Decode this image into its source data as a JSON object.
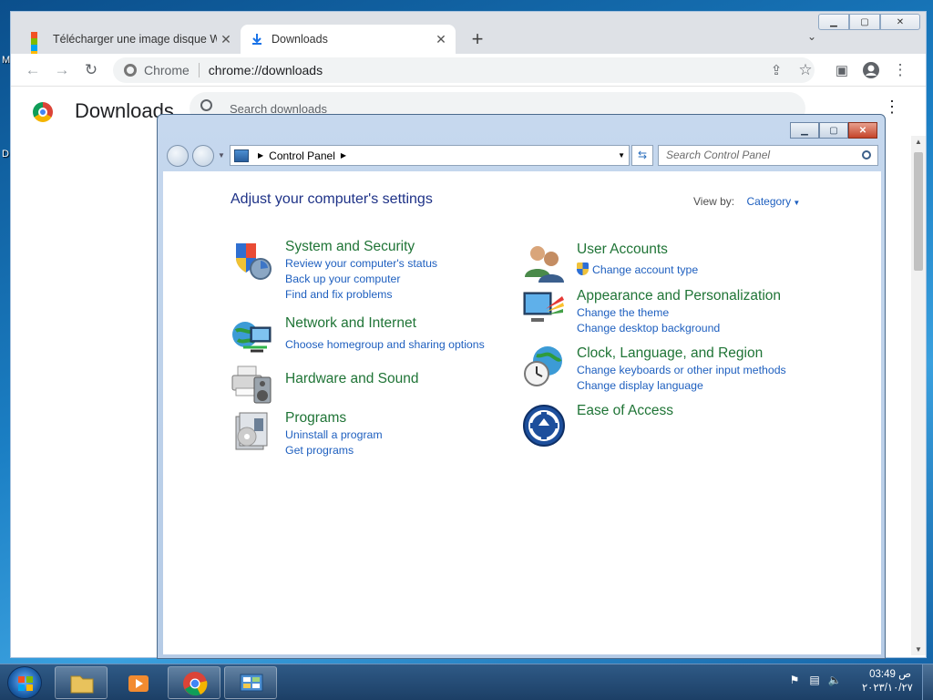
{
  "desktop": {
    "left_labels": [
      "M",
      "D"
    ]
  },
  "chrome": {
    "tabs": [
      {
        "label": "Télécharger une image disque W",
        "close": "✕"
      },
      {
        "label": "Downloads",
        "close": "✕"
      }
    ],
    "new_tab": "+",
    "omnibox": {
      "site_name": "Chrome",
      "url": "chrome://downloads"
    },
    "downloads": {
      "title": "Downloads",
      "search_placeholder": "Search downloads"
    }
  },
  "control_panel": {
    "address": "Control Panel",
    "search_placeholder": "Search Control Panel",
    "heading": "Adjust your computer's settings",
    "view_by_label": "View by:",
    "view_by_value": "Category",
    "categories_left": [
      {
        "title": "System and Security",
        "icon": "shield-icon",
        "links": [
          "Review your computer's status",
          "Back up your computer",
          "Find and fix problems"
        ]
      },
      {
        "title": "Network and Internet",
        "icon": "globe-network-icon",
        "links": [
          "Choose homegroup and sharing options"
        ]
      },
      {
        "title": "Hardware and Sound",
        "icon": "printer-speaker-icon",
        "links": []
      },
      {
        "title": "Programs",
        "icon": "programs-icon",
        "links": [
          "Uninstall a program",
          "Get programs"
        ]
      }
    ],
    "categories_right": [
      {
        "title": "User Accounts",
        "icon": "users-icon",
        "links": [
          "Change account type"
        ]
      },
      {
        "title": "Appearance and Personalization",
        "icon": "monitor-palette-icon",
        "links": [
          "Change the theme",
          "Change desktop background"
        ]
      },
      {
        "title": "Clock, Language, and Region",
        "icon": "clock-globe-icon",
        "links": [
          "Change keyboards or other input methods",
          "Change display language"
        ]
      },
      {
        "title": "Ease of Access",
        "icon": "ease-of-access-icon",
        "links": []
      }
    ]
  },
  "taskbar": {
    "clock_time": "03:49 ص",
    "clock_date": "٢٠٢٣/١٠/٢٧"
  }
}
